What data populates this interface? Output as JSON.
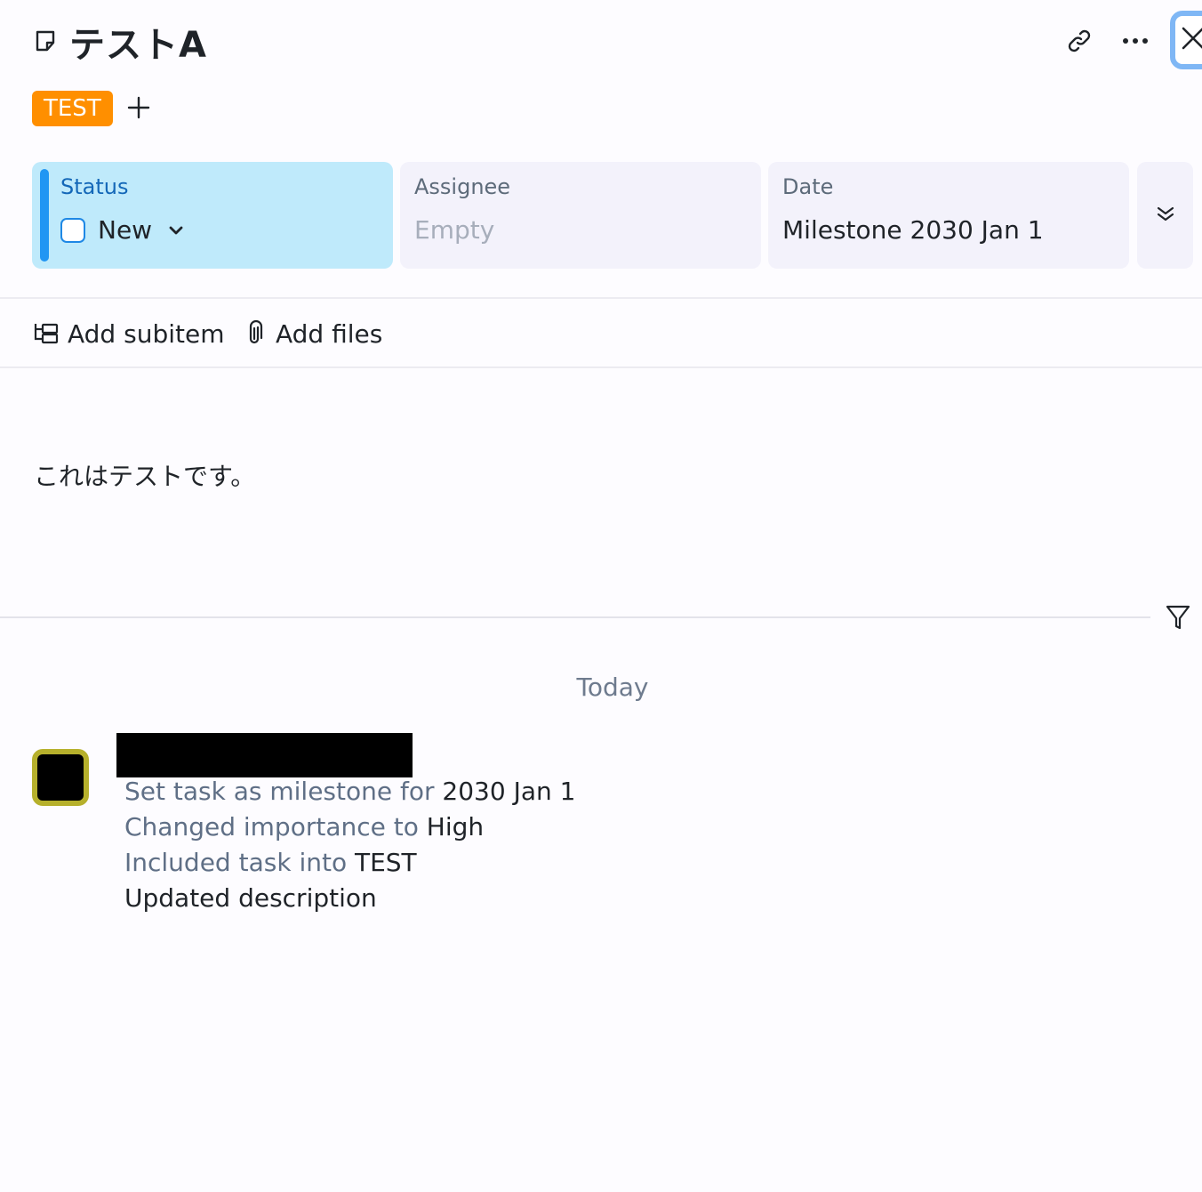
{
  "header": {
    "title": "テストA",
    "icons": [
      "task-note-icon",
      "link-icon",
      "more-icon",
      "close-icon"
    ]
  },
  "tags": [
    {
      "label": "TEST",
      "color": "#ff8f00"
    }
  ],
  "fields": {
    "status": {
      "label": "Status",
      "value": "New"
    },
    "assignee": {
      "label": "Assignee",
      "value": "Empty"
    },
    "date": {
      "label": "Date",
      "value": "Milestone 2030 Jan 1"
    }
  },
  "actions": {
    "add_subitem": "Add subitem",
    "add_files": "Add files"
  },
  "description": "これはテストです。",
  "activity": {
    "group_label": "Today",
    "entries": [
      {
        "prefix": "Set task as milestone for ",
        "value": "2030 Jan 1"
      },
      {
        "prefix": "Changed importance to ",
        "value": "High"
      },
      {
        "prefix": "Included task into ",
        "value": "TEST"
      },
      {
        "prefix": "",
        "value": "Updated description"
      }
    ]
  },
  "colors": {
    "accent": "#2196f3",
    "tag": "#ff8f00",
    "status_bg": "#bfeafb",
    "avatar_border": "#b6b02c"
  }
}
